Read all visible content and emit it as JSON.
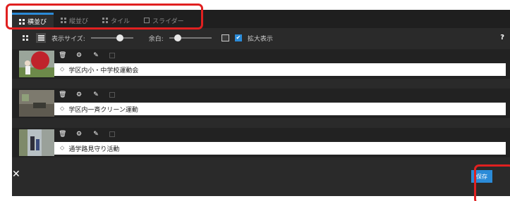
{
  "tabs": [
    {
      "label": "横並び",
      "icon": "grid-icon",
      "active": true
    },
    {
      "label": "縦並び",
      "icon": "grid-icon",
      "active": false
    },
    {
      "label": "タイル",
      "icon": "grid-icon",
      "active": false
    },
    {
      "label": "スライダー",
      "icon": "slideshow-icon",
      "active": false
    }
  ],
  "toolbar": {
    "display_size_label": "表示サイズ:",
    "display_size_level": 0.72,
    "margin_label": "余白:",
    "margin_level": 0.15,
    "enlarge_label": "拡大表示",
    "enlarge_checked": true,
    "help_label": "?"
  },
  "rows": [
    {
      "caption": "学区内小・中学校運動会"
    },
    {
      "caption": "学区内一斉クリーン運動"
    },
    {
      "caption": "通学路見守り活動"
    }
  ],
  "footer": {
    "close_label": "✕",
    "save_label": "保存"
  },
  "colors": {
    "accent": "#2b8bd8",
    "highlight": "#e02020",
    "panel": "#2a2a2a"
  }
}
